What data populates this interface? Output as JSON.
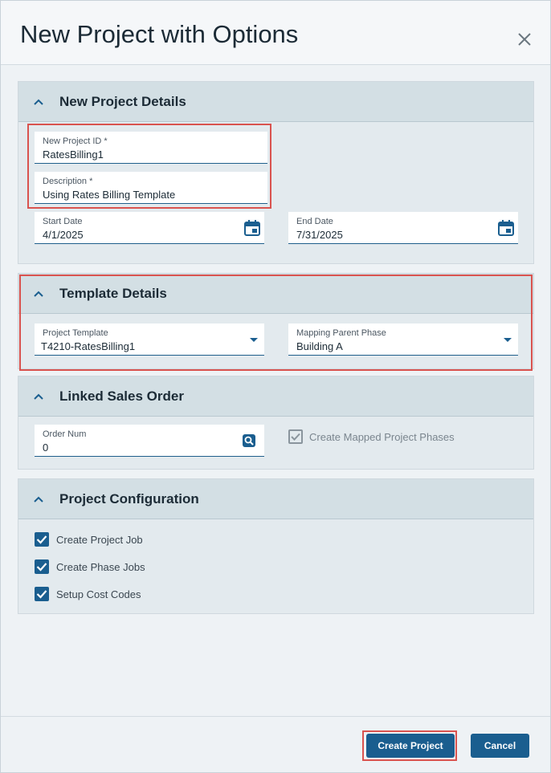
{
  "dialog": {
    "title": "New Project with Options",
    "close_icon": "close-icon"
  },
  "sections": {
    "details": {
      "title": "New Project Details",
      "project_id": {
        "label": "New Project ID *",
        "value": "RatesBilling1"
      },
      "description": {
        "label": "Description *",
        "value": "Using Rates Billing Template"
      },
      "start_date": {
        "label": "Start Date",
        "value": "4/1/2025",
        "icon": "calendar-icon"
      },
      "end_date": {
        "label": "End Date",
        "value": "7/31/2025",
        "icon": "calendar-icon"
      }
    },
    "template": {
      "title": "Template Details",
      "project_template": {
        "label": "Project Template",
        "value": "T4210-RatesBilling1",
        "icon": "dropdown-arrow-icon"
      },
      "mapping_parent_phase": {
        "label": "Mapping Parent Phase",
        "value": "Building A",
        "icon": "dropdown-arrow-icon"
      }
    },
    "sales_order": {
      "title": "Linked Sales Order",
      "order_num": {
        "label": "Order Num",
        "value": "0",
        "icon": "search-icon"
      },
      "create_mapped_phases": {
        "label": "Create Mapped Project Phases",
        "checked": true,
        "enabled": false
      }
    },
    "configuration": {
      "title": "Project Configuration",
      "options": [
        {
          "label": "Create Project Job",
          "checked": true
        },
        {
          "label": "Create Phase Jobs",
          "checked": true
        },
        {
          "label": "Setup Cost Codes",
          "checked": true
        }
      ]
    }
  },
  "footer": {
    "create_label": "Create Project",
    "cancel_label": "Cancel"
  },
  "colors": {
    "accent": "#1a5e8f",
    "highlight": "#d9534f",
    "panel_header": "#d3dfe4",
    "panel_body": "#e3eaee"
  }
}
